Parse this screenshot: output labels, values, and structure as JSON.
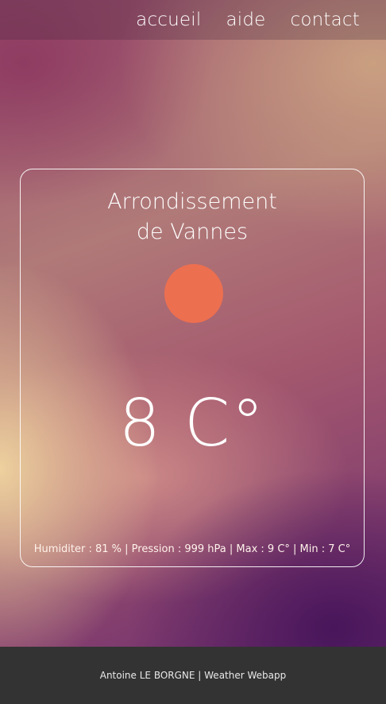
{
  "nav": {
    "items": [
      {
        "label": "accueil"
      },
      {
        "label": "aide"
      },
      {
        "label": "contact"
      }
    ]
  },
  "weather": {
    "city_line1": "Arrondissement",
    "city_line2": "de Vannes",
    "icon": "sun-icon",
    "icon_color": "#ec6f50",
    "temperature": "8 C°",
    "details": "Humiditer : 81 % | Pression : 999 hPa | Max : 9 C° | Min : 7 C°"
  },
  "footer": {
    "text": "Antoine LE BORGNE | Weather Webapp"
  }
}
